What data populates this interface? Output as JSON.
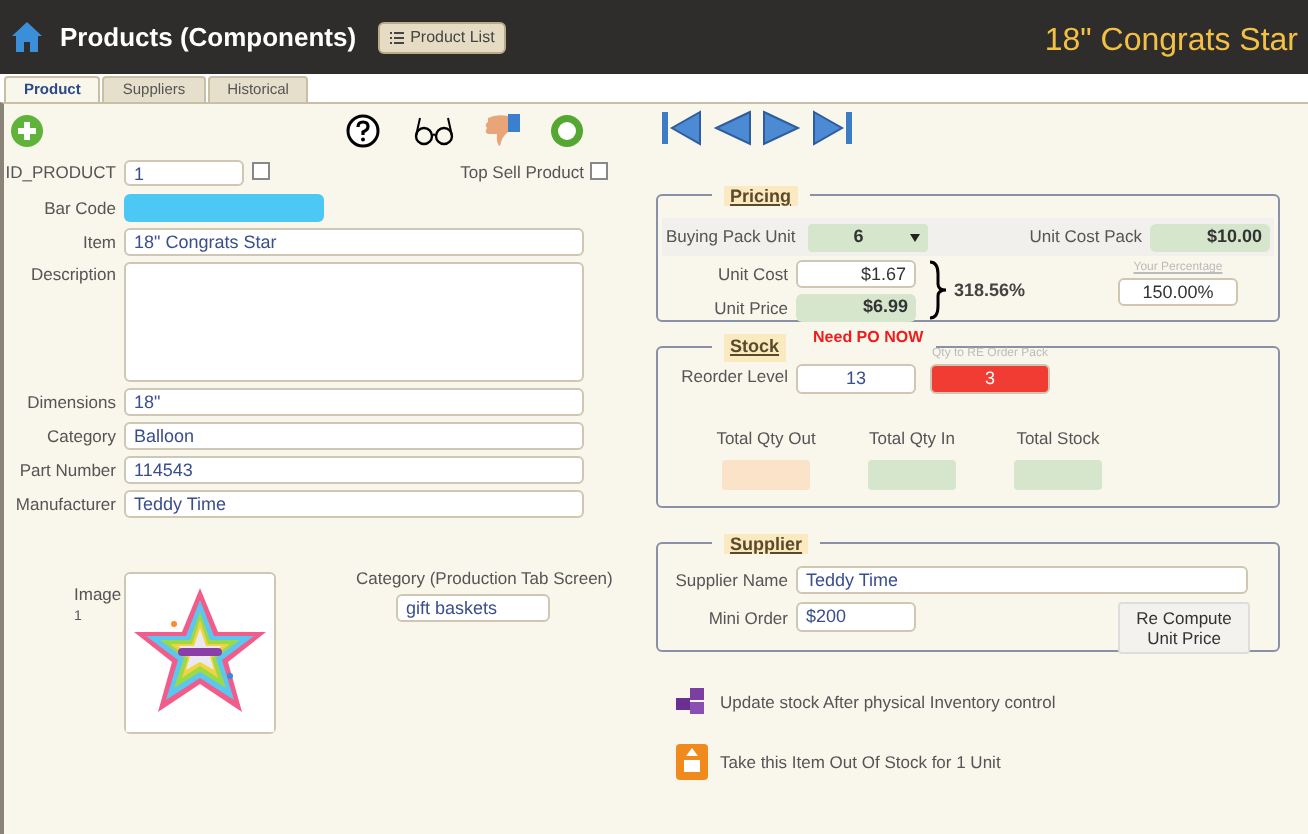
{
  "header": {
    "title": "Products (Components)",
    "list_button": "Product List",
    "record_title": "18\" Congrats Star"
  },
  "tabs": [
    {
      "label": "Product",
      "selected": true
    },
    {
      "label": "Suppliers",
      "selected": false
    },
    {
      "label": "Historical",
      "selected": false
    }
  ],
  "product": {
    "id_label": "ID_PRODUCT",
    "id_value": "1",
    "id_checked": false,
    "top_sell_label": "Top Sell Product",
    "top_sell_checked": false,
    "fields": [
      {
        "label": "Bar Code",
        "kind": "barcode"
      },
      {
        "label": "Item",
        "value": "18\" Congrats Star",
        "kind": "text"
      },
      {
        "label": "Description",
        "kind": "textarea"
      },
      {
        "label": "Dimensions",
        "value": "18\"",
        "kind": "text"
      },
      {
        "label": "Category",
        "value": "Balloon",
        "kind": "text"
      },
      {
        "label": "Part Number",
        "value": "114543",
        "kind": "text"
      },
      {
        "label": "Manufacturer",
        "value": "Teddy Time",
        "kind": "text"
      }
    ],
    "image": {
      "label": "Image",
      "index": "1",
      "kind": "picture"
    },
    "production_category": {
      "label": "Category (Production Tab Screen)",
      "value": "gift baskets"
    }
  },
  "pricing": {
    "title": "Pricing",
    "buying_pack_label": "Buying Pack Unit",
    "buying_pack_value": "6",
    "unit_cost_pack_label": "Unit Cost Pack",
    "unit_cost_pack_value": "$10.00",
    "unit_cost_label": "Unit Cost",
    "unit_cost_value": "$1.67",
    "unit_price_label": "Unit Price",
    "unit_price_value": "$6.99",
    "markup": "318.56%",
    "percentage_label": "Your Percentage",
    "percentage_value": "150.00%"
  },
  "stock": {
    "title": "Stock",
    "alert": "Need PO NOW",
    "reorder_label": "Reorder Level",
    "reorder_value": "13",
    "reorder_pack_label": "Qty to RE Order Pack",
    "reorder_pack_value": "3",
    "totals": [
      {
        "label": "Total Qty Out",
        "color": "#fbe3c9"
      },
      {
        "label": "Total Qty In",
        "color": "#d6e6cd"
      },
      {
        "label": "Total Stock",
        "color": "#d6e6cd"
      }
    ]
  },
  "supplier": {
    "title": "Supplier",
    "name_label": "Supplier Name",
    "name_value": "Teddy Time",
    "min_order_label": "Mini Order",
    "min_order_value": "$200",
    "recompute_button": "Re Compute Unit Price"
  },
  "actions": [
    {
      "label": "Update stock After physical Inventory control",
      "kind": "inventory"
    },
    {
      "label": "Take this Item Out Of Stock for 1 Unit",
      "kind": "take-out"
    }
  ]
}
